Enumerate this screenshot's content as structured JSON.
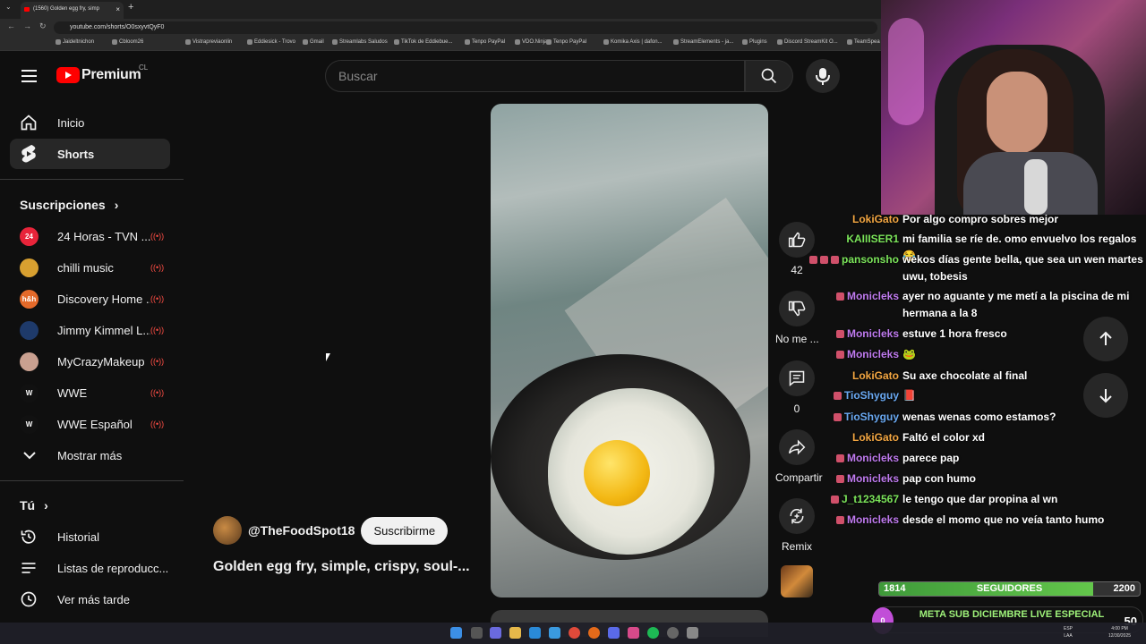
{
  "browser": {
    "tab_title": "(1560) Golden egg fry, simp",
    "url": "youtube.com/shorts/O0sxyvtQyF0",
    "bookmarks": [
      "Jaideltnichon",
      "Cbloom26",
      "Vistrapreviaonlin",
      "Eddiesick - Trovo",
      "Gmail",
      "Streamlabs Saludos",
      "TikTok de Eddiebue...",
      "Tenpo PayPal",
      "VDO.Ninja",
      "Tenpo PayPal",
      "Komika Axis | dafon...",
      "StreamElements - ja...",
      "Plugins",
      "Discord StreamKit O...",
      "TeamSpea"
    ]
  },
  "header": {
    "brand": "Premium",
    "country": "CL",
    "search_placeholder": "Buscar"
  },
  "sidebar": {
    "nav": [
      {
        "label": "Inicio",
        "icon": "home-icon"
      },
      {
        "label": "Shorts",
        "icon": "shorts-icon",
        "active": true
      }
    ],
    "subscriptions_title": "Suscripciones",
    "subscriptions": [
      {
        "name": "24 Horas - TVN ...",
        "avatar_text": "24",
        "color": "#e8243a"
      },
      {
        "name": "chilli music",
        "avatar_text": "",
        "color": "#d8a030"
      },
      {
        "name": "Discovery Home ...",
        "avatar_text": "h&h",
        "color": "#e56a2a"
      },
      {
        "name": "Jimmy Kimmel L...",
        "avatar_text": "",
        "color": "#1e3a6a"
      },
      {
        "name": "MyCrazyMakeup",
        "avatar_text": "",
        "color": "#c9a090"
      },
      {
        "name": "WWE",
        "avatar_text": "W",
        "color": "#111111"
      },
      {
        "name": "WWE Español",
        "avatar_text": "W",
        "color": "#111111"
      }
    ],
    "show_more": "Mostrar más",
    "you_title": "Tú",
    "you_items": [
      {
        "label": "Historial",
        "icon": "history-icon"
      },
      {
        "label": "Listas de reproducc...",
        "icon": "playlists-icon"
      },
      {
        "label": "Ver más tarde",
        "icon": "watch-later-icon"
      }
    ]
  },
  "short": {
    "channel": "@TheFoodSpot18",
    "subscribe_label": "Suscribirme",
    "title": "Golden egg fry, simple, crispy, soul-...",
    "likes": "42",
    "dislike_label": "No me ...",
    "comments": "0",
    "share_label": "Compartir",
    "remix_label": "Remix"
  },
  "chat": [
    {
      "user": "LokiGato",
      "color": "#f4a742",
      "text": "Por algo compro sobres mejor",
      "badges": 0
    },
    {
      "user": "KAIIISER1",
      "color": "#7be45a",
      "text": "mi familia se ríe de. omo envuelvo los regalos 😂",
      "badges": 0
    },
    {
      "user": "pansonsho",
      "color": "#7be45a",
      "text": "wekos días gente bella, que sea un wen martes uwu, tobesis",
      "badges": 3
    },
    {
      "user": "Monicleks",
      "color": "#c07bf0",
      "text": "ayer no aguante y me metí a la piscina de mi hermana a la 8",
      "badges": 1
    },
    {
      "user": "Monicleks",
      "color": "#c07bf0",
      "text": "estuve 1 hora fresco",
      "badges": 1
    },
    {
      "user": "Monicleks",
      "color": "#c07bf0",
      "text": "🐸",
      "badges": 1
    },
    {
      "user": "LokiGato",
      "color": "#f4a742",
      "text": "Su axe chocolate al final",
      "badges": 0
    },
    {
      "user": "TioShyguy",
      "color": "#6aa9f2",
      "text": "📕",
      "badges": 1
    },
    {
      "user": "TioShyguy",
      "color": "#6aa9f2",
      "text": "wenas wenas como estamos?",
      "badges": 1
    },
    {
      "user": "LokiGato",
      "color": "#f4a742",
      "text": "Faltó el color xd",
      "badges": 0
    },
    {
      "user": "Monicleks",
      "color": "#c07bf0",
      "text": "parece pap",
      "badges": 1
    },
    {
      "user": "Monicleks",
      "color": "#c07bf0",
      "text": "pap con humo",
      "badges": 1
    },
    {
      "user": "J_t1234567",
      "color": "#7be45a",
      "text": "le tengo que dar propina al wn",
      "badges": 1
    },
    {
      "user": "Monicleks",
      "color": "#c07bf0",
      "text": "desde el momo que no veía tanto humo",
      "badges": 1
    }
  ],
  "overlay": {
    "followers_current": "1814",
    "followers_label": "SEGUIDORES",
    "followers_goal": "2200",
    "followers_progress": 0.82,
    "goal_count": "0",
    "goal_title": "META SUB DICIEMBRE LIVE ESPECIAL",
    "goal_target": "50"
  },
  "taskbar": {
    "lang": "ESP",
    "lang_sub": "LAA",
    "time": "4:00 PM",
    "date": "12/30/2025"
  }
}
